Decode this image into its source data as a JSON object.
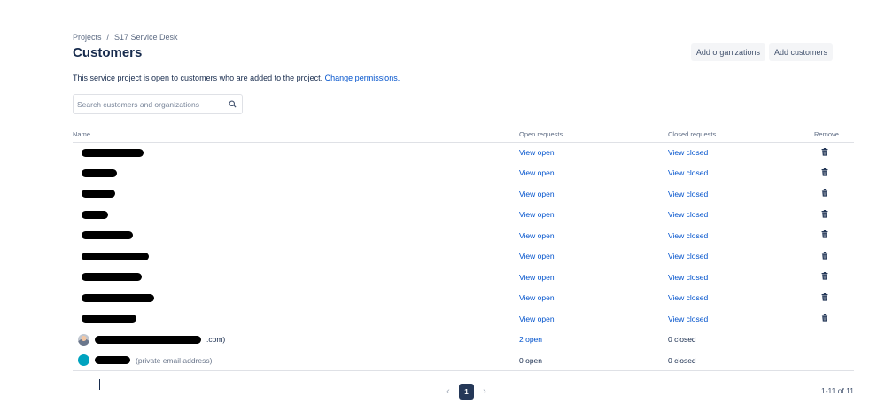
{
  "breadcrumb": {
    "items": [
      "Projects",
      "S17 Service Desk"
    ],
    "separator": "/"
  },
  "page": {
    "title": "Customers"
  },
  "actions": {
    "add_organizations": "Add organizations",
    "add_customers": "Add customers"
  },
  "intro": {
    "text": "This service project is open to customers who are added to the project. ",
    "link": "Change permissions."
  },
  "search": {
    "placeholder": "Search customers and organizations",
    "value": ""
  },
  "table": {
    "headers": {
      "name": "Name",
      "open": "Open requests",
      "closed": "Closed requests",
      "remove": "Remove"
    },
    "rows": [
      {
        "name_suffix": "",
        "open": "View open",
        "closed": "View closed",
        "open_is_link": true,
        "removable": true
      },
      {
        "name_suffix": "",
        "open": "View open",
        "closed": "View closed",
        "open_is_link": true,
        "removable": true
      },
      {
        "name_suffix": "",
        "open": "View open",
        "closed": "View closed",
        "open_is_link": true,
        "removable": true
      },
      {
        "name_suffix": "",
        "open": "View open",
        "closed": "View closed",
        "open_is_link": true,
        "removable": true
      },
      {
        "name_suffix": "",
        "open": "View open",
        "closed": "View closed",
        "open_is_link": true,
        "removable": true
      },
      {
        "name_suffix": "",
        "open": "View open",
        "closed": "View closed",
        "open_is_link": true,
        "removable": true
      },
      {
        "name_suffix": "",
        "open": "View open",
        "closed": "View closed",
        "open_is_link": true,
        "removable": true
      },
      {
        "name_suffix": "",
        "open": "View open",
        "closed": "View closed",
        "open_is_link": true,
        "removable": true
      },
      {
        "name_suffix": "",
        "open": "View open",
        "closed": "View closed",
        "open_is_link": true,
        "removable": true
      },
      {
        "name_suffix": ".com)",
        "open": "2 open",
        "closed": "0 closed",
        "open_is_link": true,
        "removable": false,
        "avatar": "person"
      },
      {
        "name_suffix": "(private email address)",
        "open": "0 open",
        "closed": "0 closed",
        "open_is_link": false,
        "removable": false,
        "avatar": "teal"
      }
    ]
  },
  "pagination": {
    "current_page": "1",
    "prev": "‹",
    "next": "›",
    "count": "1-11 of 11"
  },
  "colors": {
    "link": "#0052cc",
    "text": "#172b4d",
    "muted": "#5e6c84",
    "page_active": "#253858"
  },
  "icons": {
    "search": "search-icon",
    "trash": "trash-icon",
    "prev": "chevron-left-icon",
    "next": "chevron-right-icon"
  }
}
